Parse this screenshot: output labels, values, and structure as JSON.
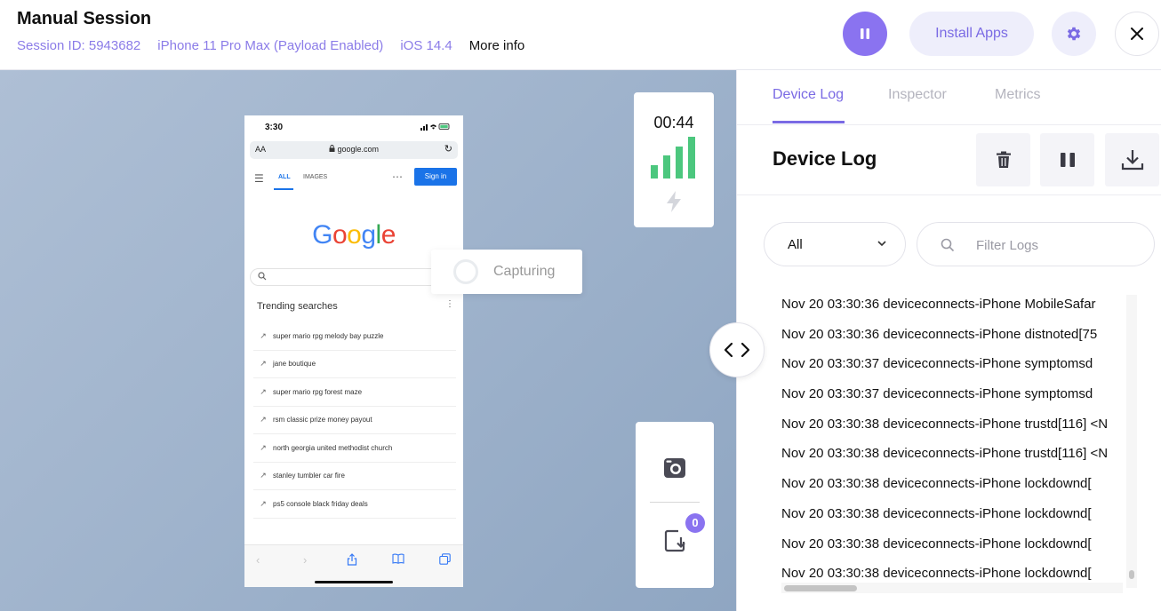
{
  "header": {
    "title": "Manual Session",
    "session_id": "Session ID: 5943682",
    "device": "iPhone 11 Pro Max (Payload Enabled)",
    "os": "iOS 14.4",
    "more_info": "More info",
    "install_apps": "Install Apps"
  },
  "phone": {
    "time": "3:30",
    "text_size": "AA",
    "url": "google.com",
    "nav_all": "ALL",
    "nav_images": "IMAGES",
    "sign_in": "Sign in",
    "logo": "Google",
    "trending_title": "Trending searches",
    "trending": [
      "super mario rpg melody bay puzzle",
      "jane boutique",
      "super mario rpg forest maze",
      "rsm classic prize money payout",
      "north georgia united methodist church",
      "stanley tumbler car fire",
      "ps5 console black friday deals"
    ]
  },
  "capturing": {
    "label": "Capturing"
  },
  "timer": {
    "value": "00:44"
  },
  "tools": {
    "badge_count": "0"
  },
  "panel": {
    "tabs": [
      "Device Log",
      "Inspector",
      "Metrics"
    ],
    "active_tab": "Device Log",
    "title": "Device Log",
    "filter_select": "All",
    "filter_placeholder": "Filter Logs",
    "logs": [
      "Nov 20 03:30:36 deviceconnects-iPhone MobileSafar",
      "Nov 20 03:30:36 deviceconnects-iPhone distnoted[75",
      "Nov 20 03:30:37 deviceconnects-iPhone symptomsd",
      "Nov 20 03:30:37 deviceconnects-iPhone symptomsd",
      "Nov 20 03:30:38 deviceconnects-iPhone trustd[116] <N",
      "Nov 20 03:30:38 deviceconnects-iPhone trustd[116] <N",
      "Nov 20 03:30:38 deviceconnects-iPhone lockdownd[",
      "Nov 20 03:30:38 deviceconnects-iPhone lockdownd[",
      "Nov 20 03:30:38 deviceconnects-iPhone lockdownd[",
      "Nov 20 03:30:38 deviceconnects-iPhone lockdownd["
    ]
  },
  "colors": {
    "accent": "#8a73f0",
    "accent_text": "#7a6ae4",
    "signal_green": "#4cc77e"
  }
}
